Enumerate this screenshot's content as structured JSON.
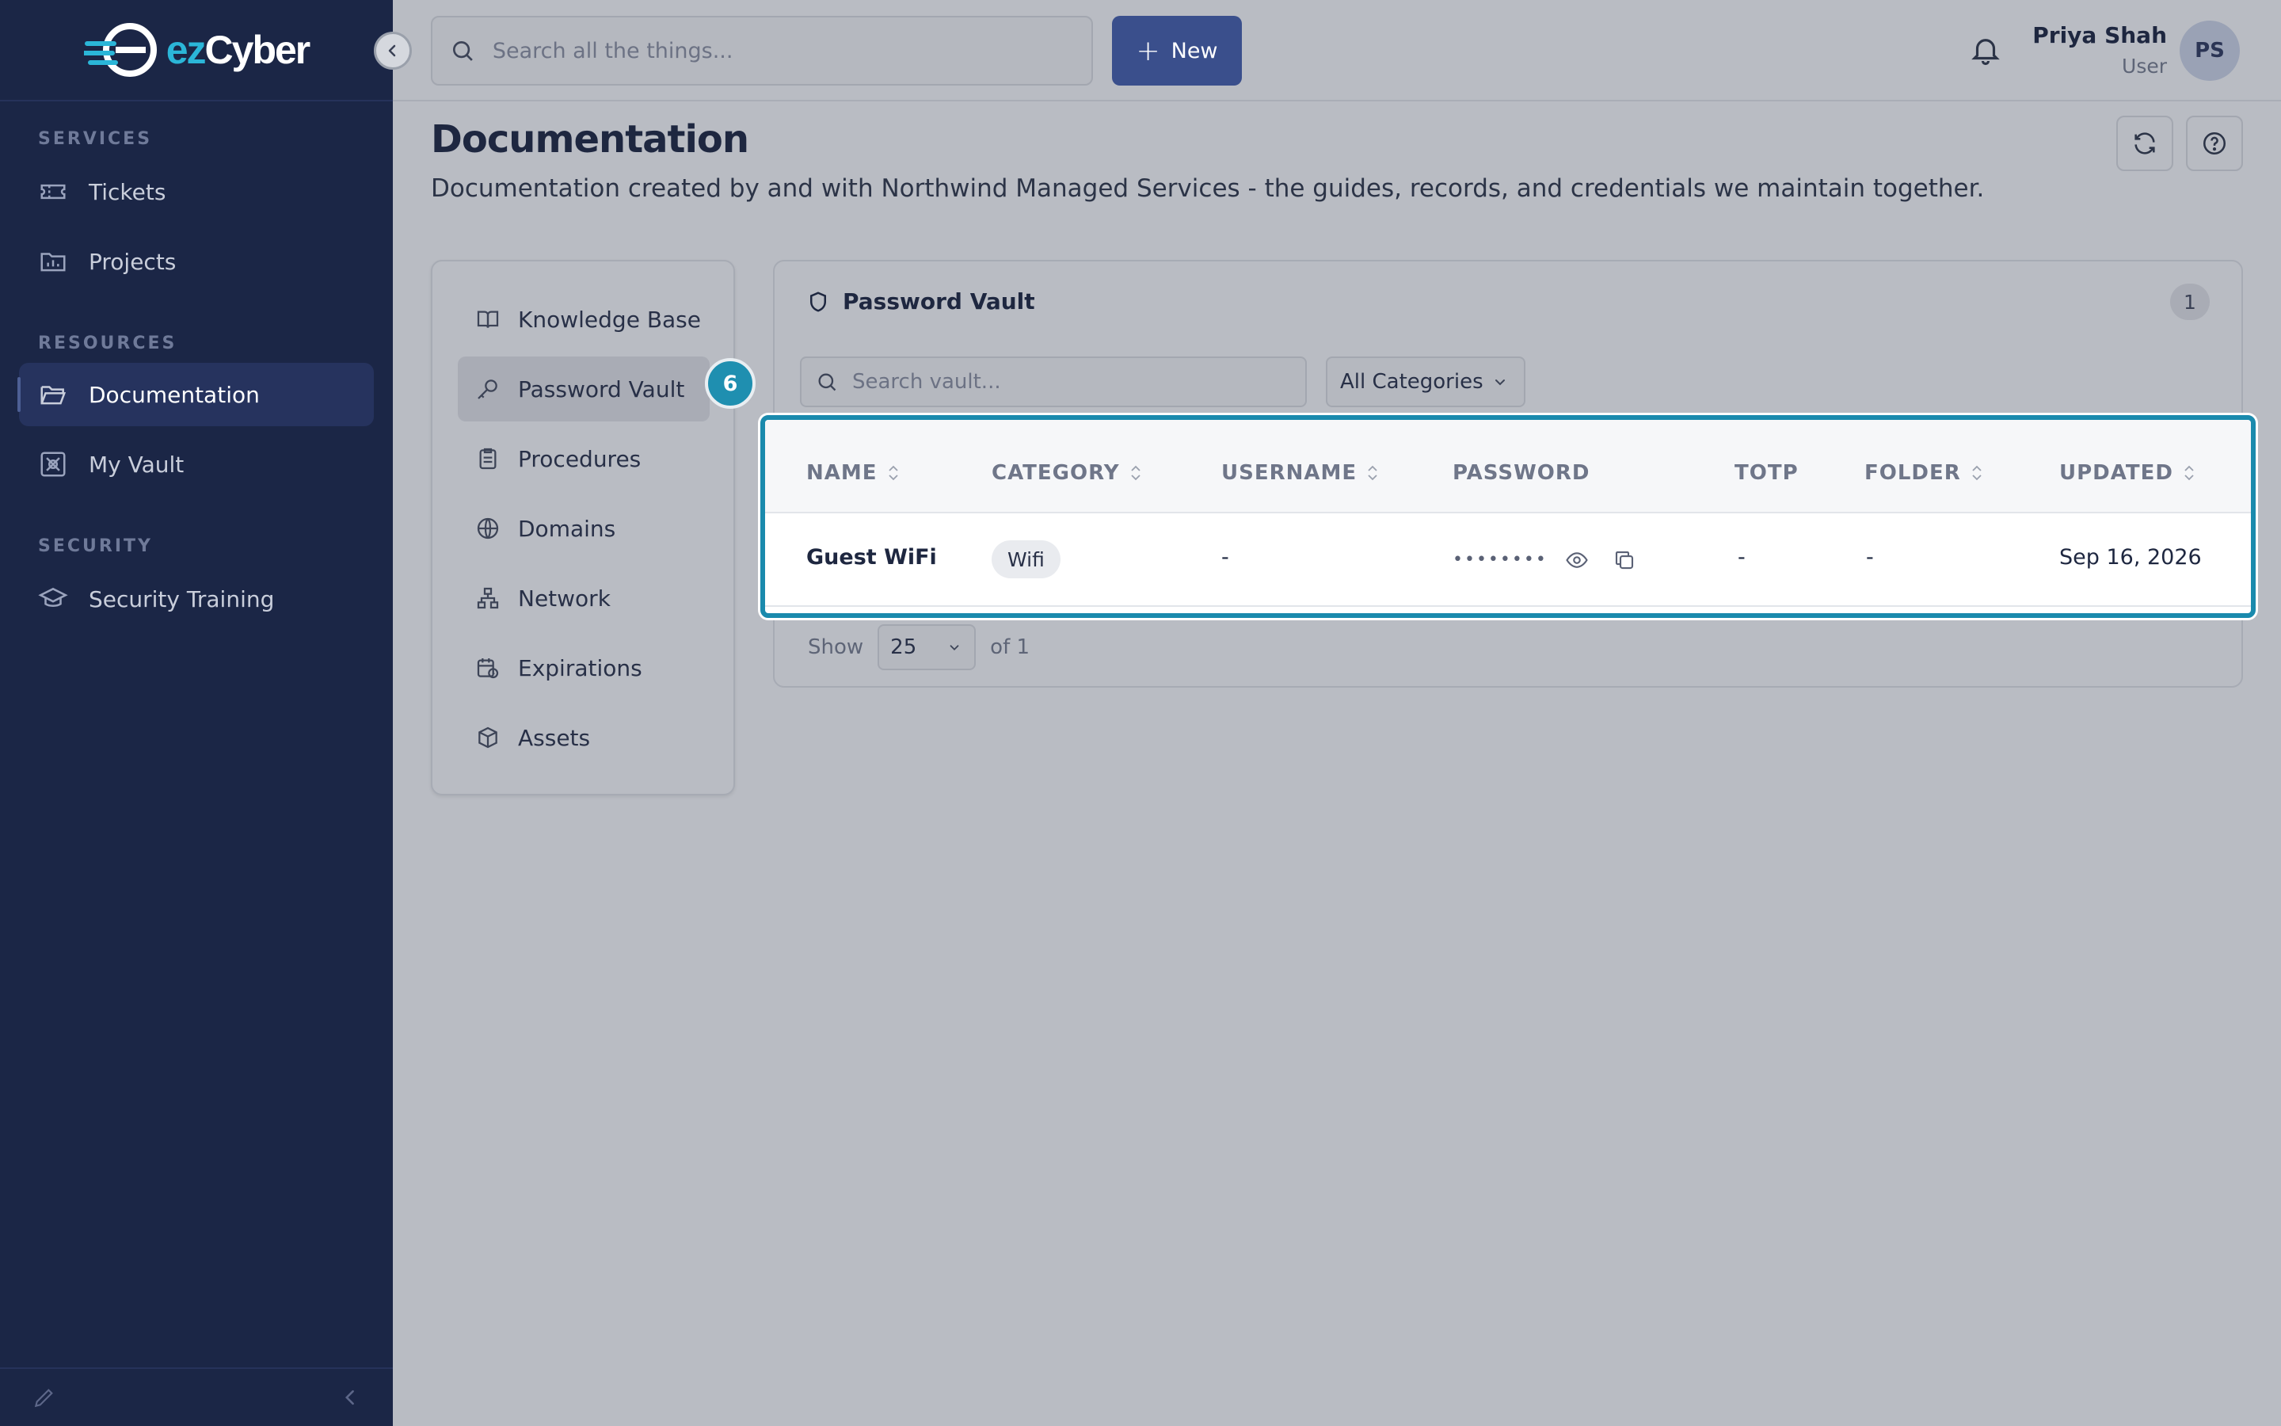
{
  "brand": {
    "logo_ez": "ez",
    "logo_cyber": "Cyber"
  },
  "sidebar": {
    "sections": [
      {
        "label": "SERVICES"
      },
      {
        "label": "RESOURCES"
      },
      {
        "label": "SECURITY"
      }
    ],
    "items": [
      {
        "label": "Tickets",
        "icon": "ticket-icon"
      },
      {
        "label": "Projects",
        "icon": "folder-chart-icon"
      },
      {
        "label": "Documentation",
        "icon": "folder-open-icon",
        "active": true
      },
      {
        "label": "My Vault",
        "icon": "vault-icon"
      },
      {
        "label": "Security Training",
        "icon": "graduation-cap-icon"
      }
    ]
  },
  "topbar": {
    "search_placeholder": "Search all the things...",
    "new_label": "New",
    "user_name": "Priya Shah",
    "user_role": "User",
    "avatar_initials": "PS"
  },
  "page": {
    "title": "Documentation",
    "subtitle": "Documentation created by and with Northwind Managed Services - the guides, records, and credentials we maintain together."
  },
  "doc_nav": {
    "items": [
      {
        "label": "Knowledge Base",
        "icon": "book-icon"
      },
      {
        "label": "Password Vault",
        "icon": "key-icon",
        "active": true
      },
      {
        "label": "Procedures",
        "icon": "clipboard-icon"
      },
      {
        "label": "Domains",
        "icon": "globe-icon"
      },
      {
        "label": "Network",
        "icon": "network-icon"
      },
      {
        "label": "Expirations",
        "icon": "calendar-clock-icon"
      },
      {
        "label": "Assets",
        "icon": "box-icon"
      }
    ],
    "step_badge": "6"
  },
  "vault": {
    "title": "Password Vault",
    "count": "1",
    "search_placeholder": "Search vault...",
    "category_filter": "All Categories",
    "columns": [
      "NAME",
      "CATEGORY",
      "USERNAME",
      "PASSWORD",
      "TOTP",
      "FOLDER",
      "UPDATED"
    ],
    "rows": [
      {
        "name": "Guest WiFi",
        "category": "Wifi",
        "username": "-",
        "password": "••••••••",
        "totp": "-",
        "folder": "-",
        "updated": "Sep 16, 2026"
      }
    ],
    "pager": {
      "show_label": "Show",
      "page_size": "25",
      "of_label": "of 1"
    }
  },
  "colors": {
    "sidebar": "#1b2646",
    "accent": "#3a4f8c",
    "highlight": "#1a8aad"
  }
}
